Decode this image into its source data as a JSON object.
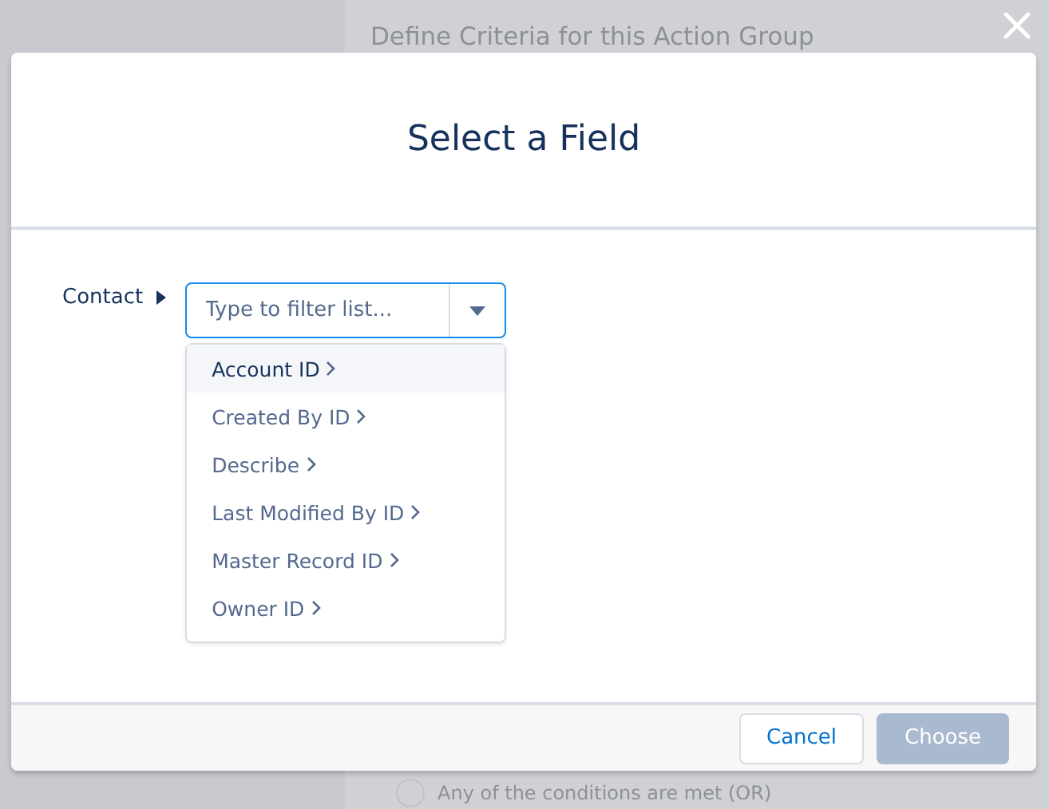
{
  "background": {
    "heading": "Define Criteria for this Action Group",
    "option": {
      "label": "Any of the conditions are met (OR)",
      "selected": false
    }
  },
  "dialog": {
    "title": "Select a Field",
    "path": [
      {
        "label": "Contact"
      }
    ],
    "combobox": {
      "placeholder": "Type to filter list..."
    },
    "options": [
      {
        "label": "Account ID",
        "selected": true
      },
      {
        "label": "Created By ID",
        "selected": false
      },
      {
        "label": "Describe",
        "selected": false
      },
      {
        "label": "Last Modified By ID",
        "selected": false
      },
      {
        "label": "Master Record ID",
        "selected": false
      },
      {
        "label": "Owner ID",
        "selected": false
      }
    ],
    "buttons": [
      {
        "label": "Cancel",
        "kind": "neutral",
        "disabled": false
      },
      {
        "label": "Choose",
        "kind": "brand",
        "disabled": true
      }
    ]
  }
}
